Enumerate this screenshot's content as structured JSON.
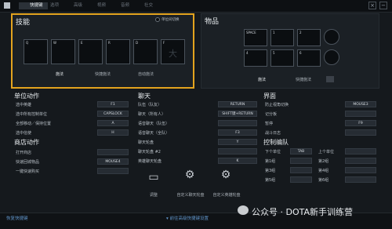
{
  "tabs": [
    "快捷键",
    "选项",
    "高级",
    "视频",
    "音频",
    "社交"
  ],
  "skills": {
    "title": "技能",
    "toggle": "单位间切换",
    "slots": [
      "Q",
      "W",
      "E",
      "R",
      "D",
      "F"
    ],
    "modes": [
      "施法",
      "快捷施法",
      "自动施法"
    ]
  },
  "items": {
    "title": "物品",
    "slots": [
      "SPACE",
      "1",
      "2",
      "4",
      "5",
      "6"
    ],
    "modes": [
      "施法",
      "快捷施法"
    ]
  },
  "unit_actions": {
    "title": "单位动作",
    "rows": [
      {
        "label": "选中英雄",
        "key": "F1"
      },
      {
        "label": "选中所有控制单位",
        "key": "CAPSLOCK"
      },
      {
        "label": "全部移动／保持位置",
        "key": "A"
      },
      {
        "label": "选中信使",
        "key": "H"
      }
    ]
  },
  "shop": {
    "title": "商店动作",
    "rows": [
      {
        "label": "打开商店",
        "key": ""
      },
      {
        "label": "快速回城物品",
        "key": "MOUSE4"
      },
      {
        "label": "一键快速购买",
        "key": ""
      }
    ]
  },
  "chat": {
    "title": "聊天",
    "rows": [
      {
        "label": "队伍（队友）",
        "key": "RETURN"
      },
      {
        "label": "聊天（所有人）",
        "key": "SHIFT键+RETURN"
      },
      {
        "label": "语音聊天（队伍）",
        "key": ""
      },
      {
        "label": "语音聊天（全队）",
        "key": "F3"
      },
      {
        "label": "聊天轮盘",
        "key": "Y"
      },
      {
        "label": "聊天轮盘 #2",
        "key": ""
      },
      {
        "label": "英雄聊天轮盘",
        "key": "K"
      }
    ],
    "buttons": [
      "调整",
      "自定义聊天轮盘",
      "自定义英雄轮盘"
    ]
  },
  "interface": {
    "title": "界面",
    "rows": [
      {
        "label": "防止视角切换",
        "key": "MOUSE3"
      },
      {
        "label": "记分板",
        "key": ""
      },
      {
        "label": "暂停",
        "key": "F9"
      },
      {
        "label": "战斗日志",
        "key": ""
      }
    ]
  },
  "control_group": {
    "title": "控制编队",
    "left": [
      "下个单位",
      "第1组",
      "第3组",
      "第5组"
    ],
    "lkeys": [
      "TAB",
      "",
      "",
      ""
    ],
    "right": [
      "上个单位",
      "第2组",
      "第4组",
      "第6组"
    ],
    "rkeys": [
      "",
      "",
      "",
      ""
    ]
  },
  "footer": {
    "reset": "恢复快捷键",
    "advanced": "前往高级快捷键设置",
    "watermark": "公众号 · DOTA新手训练营"
  }
}
